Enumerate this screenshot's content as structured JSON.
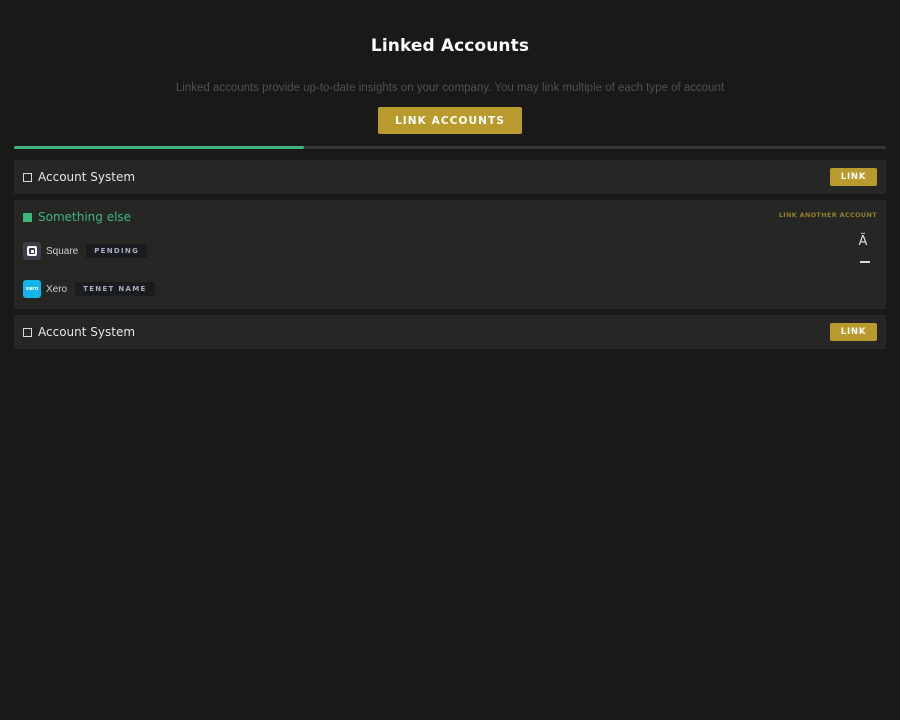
{
  "header": {
    "title": "Linked Accounts",
    "subtitle": "Linked accounts provide up-to-date insights on your company. You may link multiple of each type of account",
    "primary_button": "LINK ACCOUNTS"
  },
  "progress": {
    "fraction": 0.333
  },
  "colors": {
    "accent_gold": "#b99a2c",
    "accent_green": "#3eb57c",
    "background": "#191918",
    "card": "#262625"
  },
  "cards": [
    {
      "title": "Account System",
      "checked": false,
      "button_label": "LINK"
    },
    {
      "title": "Something else",
      "checked": true,
      "action_label": "LINK ANOTHER ACCOUNT",
      "accounts": [
        {
          "name": "Square",
          "badge": "PENDING",
          "icon": "square-logo-icon"
        },
        {
          "name": "Xero",
          "badge": "TENET NAME",
          "icon": "xero-logo-icon",
          "logo_text": "xero"
        }
      ],
      "row_glyph": "Ã"
    },
    {
      "title": "Account System",
      "checked": false,
      "button_label": "LINK"
    }
  ]
}
